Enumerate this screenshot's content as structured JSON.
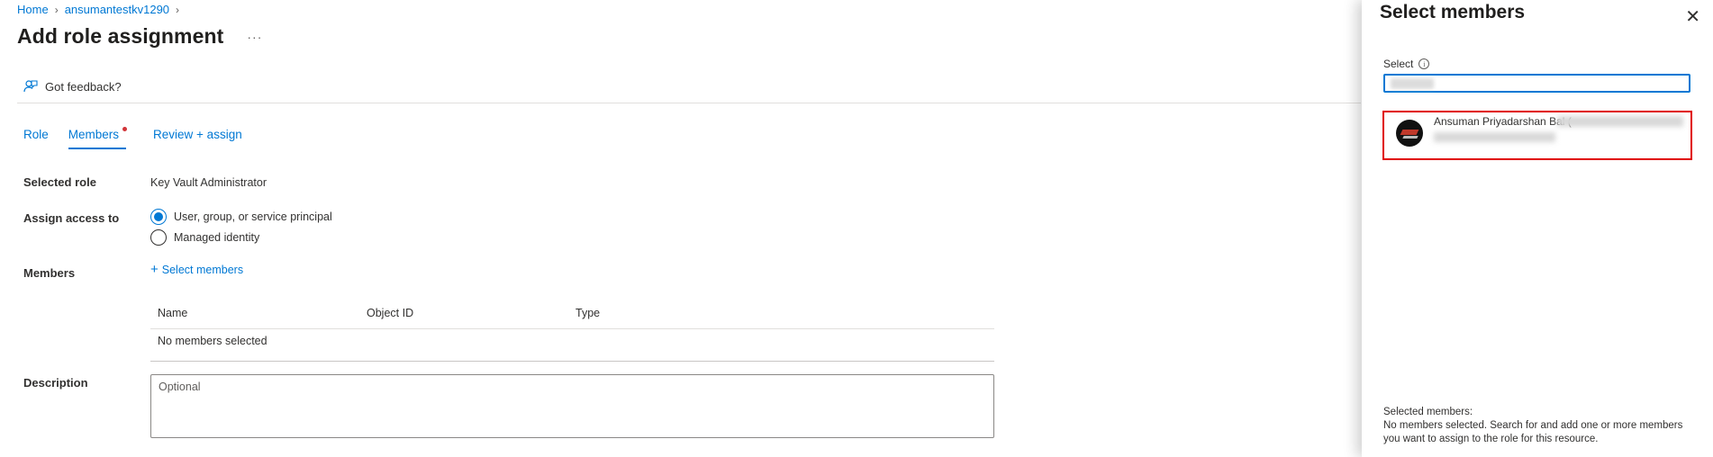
{
  "breadcrumb": {
    "home": "Home",
    "resource": "ansumantestkv1290"
  },
  "header": {
    "title": "Add role assignment",
    "more": "···"
  },
  "toolbar": {
    "feedback_label": "Got feedback?"
  },
  "tabs": [
    {
      "label": "Role"
    },
    {
      "label": "Members"
    },
    {
      "label": "Review + assign"
    }
  ],
  "form": {
    "selected_role_label": "Selected role",
    "selected_role_value": "Key Vault Administrator",
    "assign_access_label": "Assign access to",
    "options": [
      {
        "label": "User, group, or service principal",
        "checked": true
      },
      {
        "label": "Managed identity",
        "checked": false
      }
    ],
    "members_label": "Members",
    "select_members_link": "Select members",
    "table": {
      "columns": [
        "Name",
        "Object ID",
        "Type"
      ],
      "empty_text": "No members selected"
    },
    "description_label": "Description",
    "description_placeholder": "Optional"
  },
  "panel": {
    "title": "Select members",
    "close": "✕",
    "select_label": "Select",
    "info": "i",
    "result": {
      "name": "Ansuman Priyadarshan Bal ("
    },
    "selected_members_heading": "Selected members:",
    "selected_members_text": "No members selected. Search for and add one or more members you want to assign to the role for this resource."
  },
  "colors": {
    "accent": "#0078d4",
    "highlight_border": "#e00000",
    "required_dot": "#d13438"
  }
}
